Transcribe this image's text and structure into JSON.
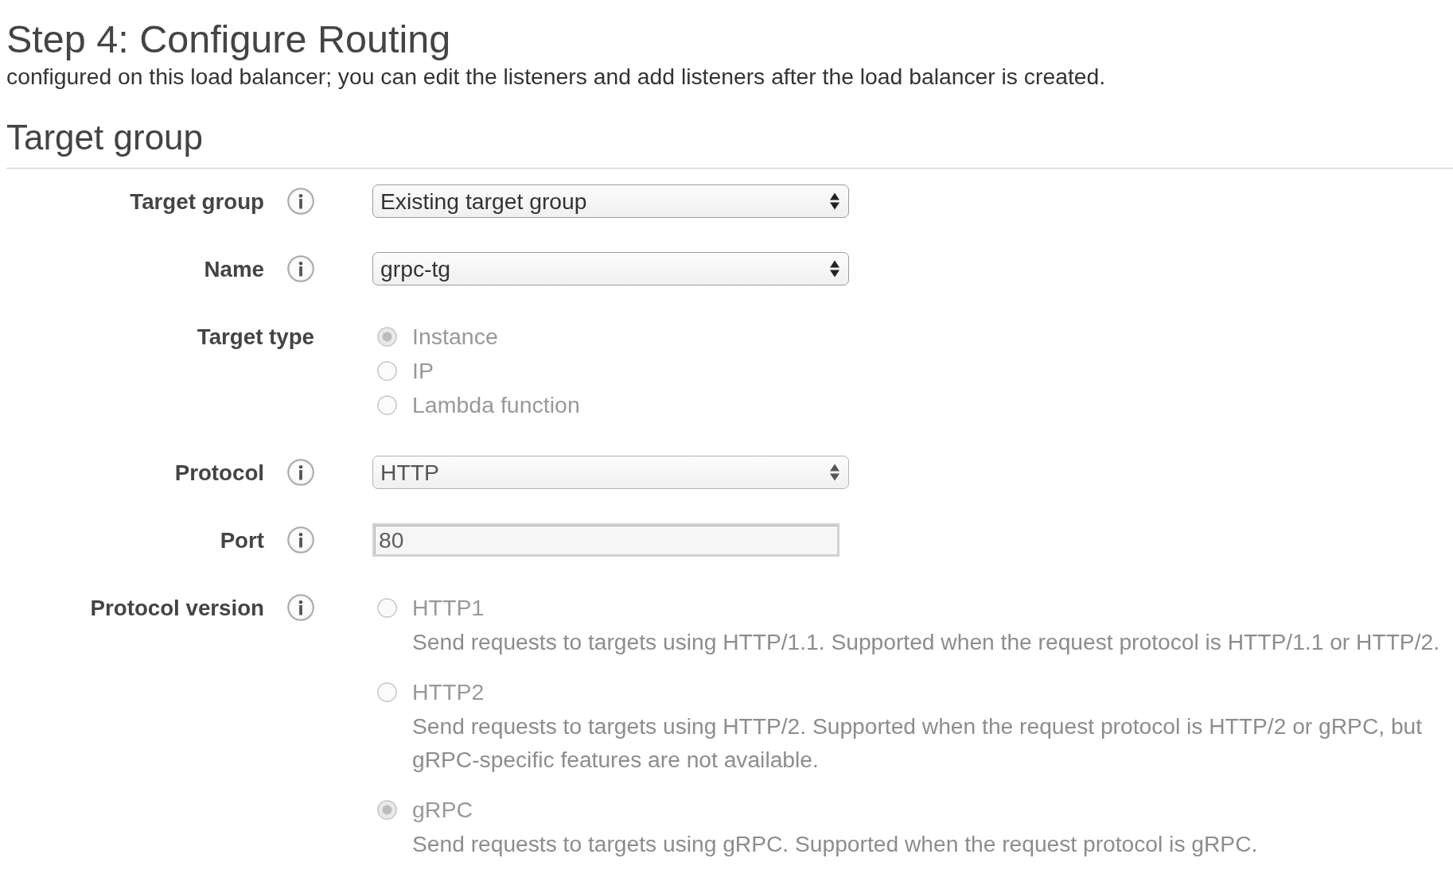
{
  "page": {
    "title": "Step 4: Configure Routing",
    "intro": "configured on this load balancer; you can edit the listeners and add listeners after the load balancer is created."
  },
  "section": {
    "title": "Target group",
    "fields": [
      {
        "kind": "select",
        "label": "Target group",
        "help_icon": true,
        "value": "Existing target group",
        "disabled": false
      },
      {
        "kind": "select",
        "label": "Name",
        "help_icon": true,
        "value": "grpc-tg",
        "disabled": false
      },
      {
        "kind": "radio",
        "label": "Target type",
        "help_icon": false,
        "disabled": true,
        "options": [
          {
            "label": "Instance",
            "selected": true
          },
          {
            "label": "IP",
            "selected": false
          },
          {
            "label": "Lambda function",
            "selected": false
          }
        ]
      },
      {
        "kind": "select",
        "label": "Protocol",
        "help_icon": true,
        "value": "HTTP",
        "disabled": true
      },
      {
        "kind": "text",
        "label": "Port",
        "help_icon": true,
        "value": "80",
        "disabled": true
      },
      {
        "kind": "radio",
        "label": "Protocol version",
        "help_icon": true,
        "disabled": true,
        "options": [
          {
            "label": "HTTP1",
            "selected": false,
            "description": "Send requests to targets using HTTP/1.1. Supported when the request protocol is HTTP/1.1 or HTTP/2."
          },
          {
            "label": "HTTP2",
            "selected": false,
            "description": "Send requests to targets using HTTP/2. Supported when the request protocol is HTTP/2 or gRPC, but gRPC-specific features are not available."
          },
          {
            "label": "gRPC",
            "selected": true,
            "description": "Send requests to targets using gRPC. Supported when the request protocol is gRPC."
          }
        ]
      }
    ]
  }
}
